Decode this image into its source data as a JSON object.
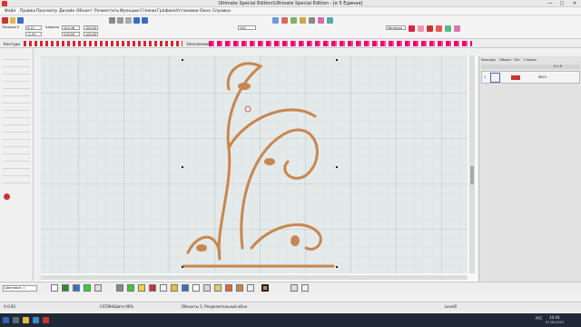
{
  "titlebar": {
    "title": "Ultimate Special Edition\\Ultimate Special Edition - [e 5  Единая]",
    "min": "—",
    "max": "□",
    "close": "✕"
  },
  "menu": [
    "Файл",
    "Правка",
    "Просмотр",
    "Дизайн",
    "Объект",
    "Разместить",
    "Функции",
    "Стежки",
    "Графика",
    "Установки",
    "Окно",
    "Справка"
  ],
  "props": {
    "pos_x_label": "Позиция X",
    "pos_x": "6.22",
    "pos_y": "-1.94",
    "width_label": "Ширина",
    "width": "104.36",
    "height": "176.99",
    "w_pct": "100.00",
    "h_pct": "100.00",
    "zoom": "100",
    "metric": "Метрика"
  },
  "props_row": {
    "contours": "Контуры",
    "fill": "Заполнение"
  },
  "color_row": {
    "selector": "Цветовые: 1"
  },
  "right": {
    "tab1": "Контуры",
    "tab2": "Объект. Тип",
    "tab3": "Стежки",
    "hdr": "0:1:0",
    "row_num": "1",
    "row_count": "6819"
  },
  "status": {
    "left": "X:0.92",
    "center": "САТИН/Шито 90%",
    "objects": "Объекты 1: Разделительный объе",
    "level": "Level0"
  },
  "taskbar": {
    "time": "14:43",
    "date": "07.09.2023",
    "lang": "РУС"
  },
  "colors": {
    "thread": "#c88650",
    "accent": "#2f62b8"
  }
}
